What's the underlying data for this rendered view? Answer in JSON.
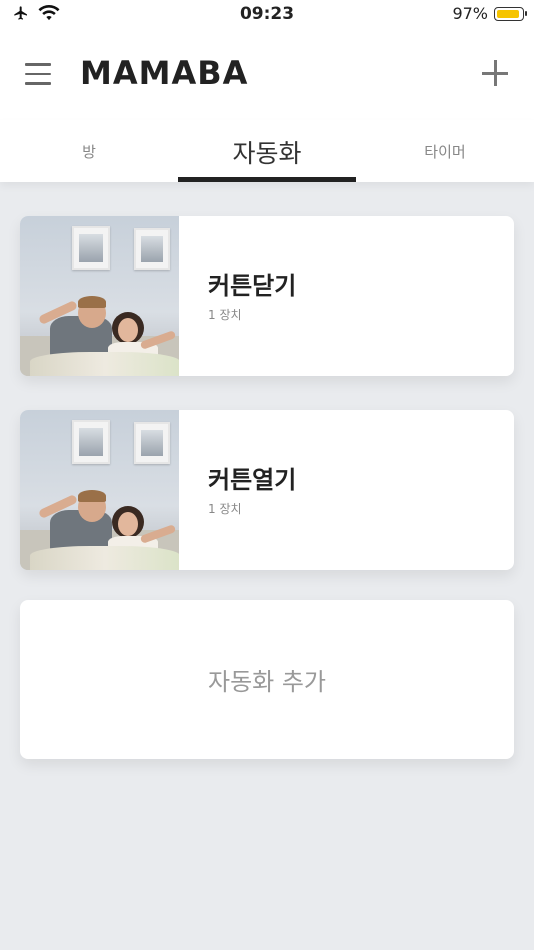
{
  "status_bar": {
    "time": "09:23",
    "battery_percent": "97%",
    "battery_level": 0.97,
    "battery_color": "#f6c400",
    "icons": [
      "airplane-icon",
      "wifi-icon",
      "battery-icon"
    ]
  },
  "header": {
    "logo": "MAMABA",
    "icons": [
      "hamburger-menu-icon",
      "plus-icon"
    ]
  },
  "tabs": [
    {
      "label": "방",
      "active": false
    },
    {
      "label": "자동화",
      "active": true
    },
    {
      "label": "타이머",
      "active": false
    }
  ],
  "automations": [
    {
      "title": "커튼닫기",
      "subtitle": "1 장치"
    },
    {
      "title": "커튼열기",
      "subtitle": "1 장치"
    }
  ],
  "add_automation_label": "자동화 추가"
}
